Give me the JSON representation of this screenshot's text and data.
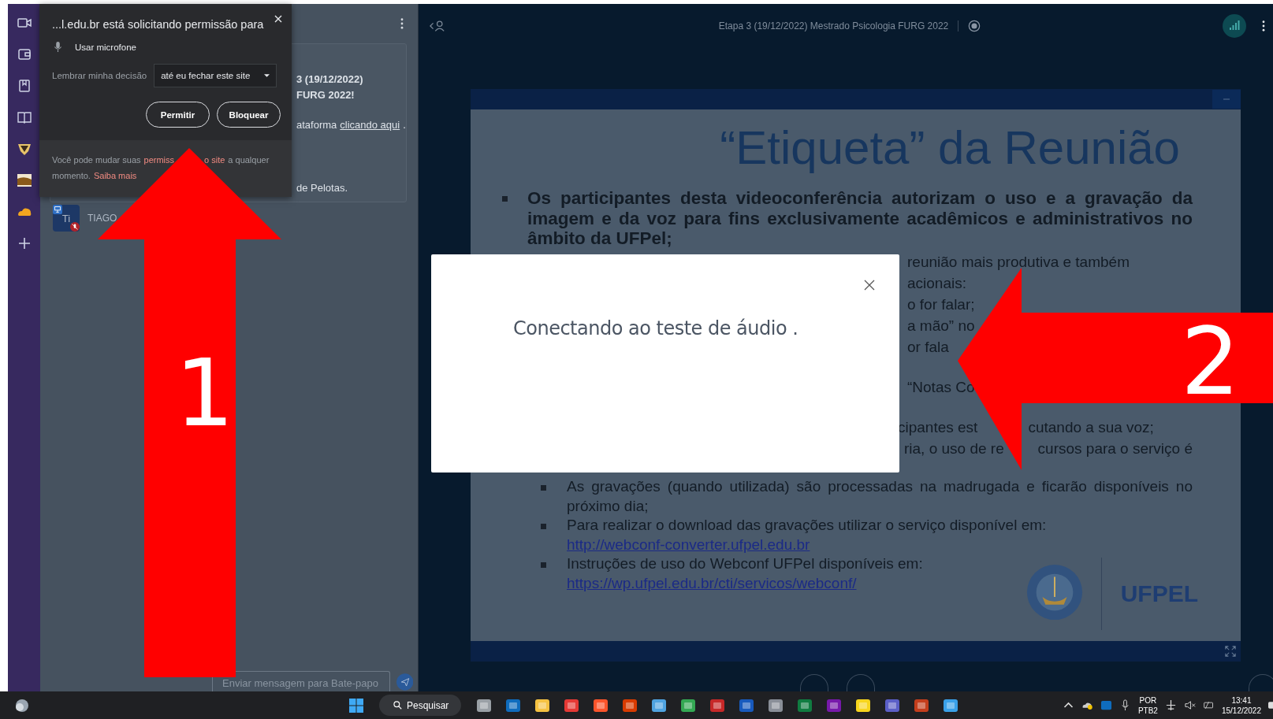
{
  "permission_popup": {
    "title": "...l.edu.br está solicitando permissão para",
    "permission": "Usar microfone",
    "remember_label": "Lembrar minha decisão",
    "remember_value": "até eu fechar este site",
    "buttons": [
      "Permitir",
      "Bloquear"
    ],
    "footer": {
      "text_1": "Você pode mudar suas",
      "link_1": "permiss",
      "link_2": "o site",
      "text_2": "a qualquer",
      "text_3": "momento.",
      "link_3": "Saiba mais"
    }
  },
  "chat": {
    "message_fragments": [
      {
        "text": "3 (19/12/2022)",
        "bold": true
      },
      {
        "text": "FURG 2022!",
        "bold": true
      },
      {
        "text": "ataforma",
        "link": "clicando aqui",
        "after": ".",
        "bold": false
      },
      {
        "text": "de Pelotas.",
        "bold": false
      }
    ],
    "user": {
      "initials": "Ti",
      "name": "TIAGO"
    },
    "input": {
      "placeholder": "Enviar mensagem para Bate-papo"
    }
  },
  "meeting": {
    "title": "Etapa 3 (19/12/2022) Mestrado Psicologia FURG 2022"
  },
  "slide": {
    "title": "“Etiqueta” da Reunião",
    "intro": "Os participantes desta videoconferência autorizam o uso e a gravação da imagem e da voz para fins exclusivamente acadêmicos e administrativos no âmbito da UFPel;",
    "visible_fragments": [
      [
        "reunião mais produtiva e também"
      ],
      [
        "acionais:"
      ],
      [
        "o for falar;"
      ],
      [
        "a mão” no"
      ],
      [
        "or fala"
      ],
      [
        "“Notas Co"
      ],
      [
        "cipantes est",
        "cutando a sua voz;"
      ],
      [
        "ria, o uso de re",
        "cursos para o serviço é"
      ]
    ],
    "items": [
      {
        "text": "As gravações (quando utilizada) são processadas na madrugada e ficarão disponíveis no próximo dia;"
      },
      {
        "text": "Para realizar o download das gravações utilizar o serviço disponível em:",
        "link": "http://webconf-converter.ufpel.edu.br"
      },
      {
        "text": "Instruções de uso do Webconf UFPel disponíveis em:",
        "link": "https://wp.ufpel.edu.br/cti/servicos/webconf/"
      }
    ],
    "logo_text": "UFPEL"
  },
  "audio_dialog": {
    "message": "Conectando ao teste de áudio ."
  },
  "annotations": [
    {
      "label": "1",
      "kind": "up-arrow"
    },
    {
      "label": "2",
      "kind": "left-arrow"
    }
  ],
  "taskbar": {
    "search": "Pesquisar",
    "language": "POR",
    "layout": "PTB2",
    "time": "13:41",
    "date": "15/12/2022"
  }
}
